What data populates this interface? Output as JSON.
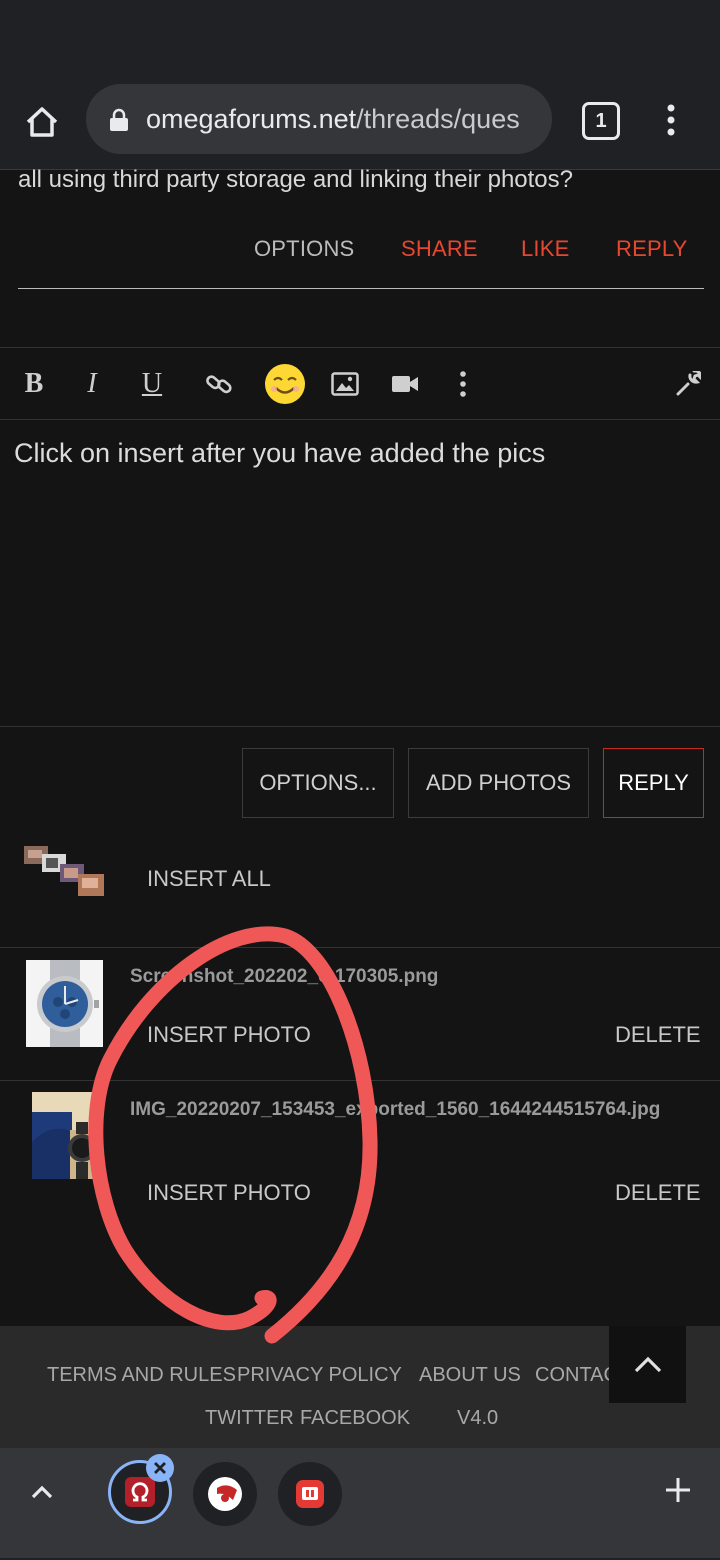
{
  "browser": {
    "url_domain": "omegaforums.net",
    "url_path": "/threads/ques",
    "tab_count": "1"
  },
  "post": {
    "text": "all using third party storage and linking their photos?",
    "actions": {
      "options": "OPTIONS",
      "share": "SHARE",
      "like": "LIKE",
      "reply": "REPLY"
    }
  },
  "editor": {
    "toolbar": {
      "bold": "B",
      "italic": "I",
      "underline": "U"
    },
    "body_text": "Click on insert after you have added the pics"
  },
  "buttons": {
    "options": "OPTIONS...",
    "add_photos": "ADD PHOTOS",
    "reply": "REPLY"
  },
  "attachments": {
    "insert_all": "INSERT ALL",
    "items": [
      {
        "filename": "Screenshot_202202_0-170305.png",
        "insert": "INSERT PHOTO",
        "delete": "DELETE"
      },
      {
        "filename": "IMG_20220207_153453_exported_1560_1644244515764.jpg",
        "insert": "INSERT PHOTO",
        "delete": "DELETE"
      }
    ]
  },
  "footer": {
    "links": [
      "TERMS AND RULES",
      "PRIVACY POLICY",
      "ABOUT US",
      "CONTAC"
    ],
    "social": [
      "TWITTER",
      "FACEBOOK"
    ],
    "version": "V4.0"
  },
  "colors": {
    "accent": "#e8472f",
    "annotation": "#f05858",
    "active_tab": "#8ab4f8"
  }
}
